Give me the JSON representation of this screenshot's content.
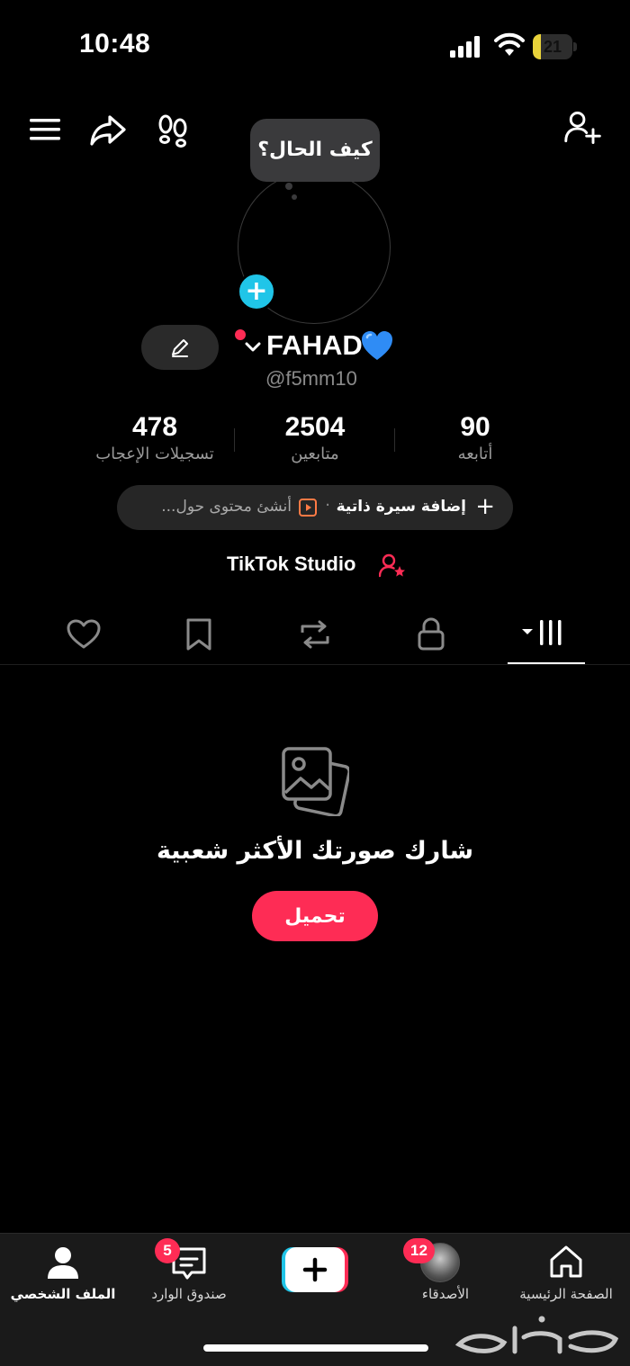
{
  "status_bar": {
    "time": "10:48",
    "battery_level": "21",
    "battery_fraction": 0.21,
    "icons": [
      "cellular-signal-icon",
      "wifi-icon",
      "battery-icon"
    ]
  },
  "top_bar": {
    "icons": [
      "menu-icon",
      "share-icon",
      "footprints-icon",
      "add-friend-icon"
    ]
  },
  "profile": {
    "note_bubble": "كيف الحال؟",
    "display_name": "FAHAD💙",
    "display_name_text": "FAHAD",
    "username": "@f5mm10",
    "stats": {
      "following": {
        "value": "90",
        "label": "أتابعه"
      },
      "followers": {
        "value": "2504",
        "label": "متابعين"
      },
      "likes": {
        "value": "478",
        "label": "تسجيلات الإعجاب"
      }
    },
    "bio_pill": {
      "add_bio": "إضافة سيرة ذاتية",
      "separator": "·",
      "create_content": "أنشئ محتوى حول..."
    },
    "studio_link": "TikTok Studio"
  },
  "tabs": [
    {
      "name": "videos",
      "icon": "grid-icon",
      "active": true
    },
    {
      "name": "private",
      "icon": "lock-icon",
      "active": false
    },
    {
      "name": "reposts",
      "icon": "repost-icon",
      "active": false
    },
    {
      "name": "favorites",
      "icon": "bookmark-icon",
      "active": false
    },
    {
      "name": "liked",
      "icon": "heart-outline-icon",
      "active": false
    }
  ],
  "empty_state": {
    "icon": "photos-icon",
    "title": "شارك صورتك الأكثر شعبية",
    "button": "تحميل"
  },
  "bottom_nav": {
    "home": {
      "label": "الصفحة الرئيسية"
    },
    "friends": {
      "label": "الأصدقاء",
      "badge": "12"
    },
    "create": {
      "icon": "create-plus-icon"
    },
    "inbox": {
      "label": "صندوق الوارد",
      "badge": "5"
    },
    "profile": {
      "label": "الملف الشخصي",
      "active": true
    }
  },
  "watermark": {
    "text": "حراج"
  },
  "colors": {
    "background": "#000000",
    "accent_pink": "#fe2c55",
    "accent_cyan": "#20c5e8",
    "battery_yellow": "#e9d33a"
  }
}
